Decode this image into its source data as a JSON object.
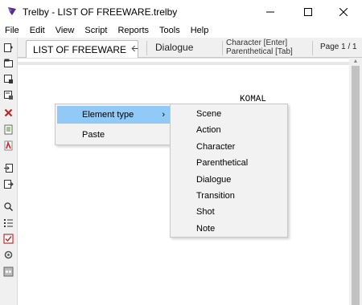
{
  "window": {
    "title": "Trelby - LIST OF FREEWARE.trelby",
    "app_icon": "trelby-logo-icon",
    "controls": [
      "minimize-icon",
      "maximize-icon",
      "close-icon"
    ]
  },
  "menubar": {
    "items": [
      "File",
      "Edit",
      "View",
      "Script",
      "Reports",
      "Tools",
      "Help"
    ]
  },
  "tabs": {
    "active_tab": "LIST OF FREEWARE",
    "current_element": "Dialogue",
    "hint_line1": "Character [Enter]",
    "hint_line2": "Parenthetical [Tab]",
    "page_indicator": "Page 1 / 1"
  },
  "toolbar": {
    "icons": [
      "new-document-icon",
      "open-icon",
      "save-icon",
      "save-as-icon",
      "close-document-icon",
      "script-settings-icon",
      "pdf-export-icon",
      "import-icon",
      "export-icon",
      "find-icon",
      "character-list-icon",
      "spellcheck-icon",
      "settings-icon",
      "about-icon"
    ]
  },
  "editor": {
    "script_text": "KOMAL"
  },
  "context_menu": {
    "items": [
      {
        "label": "Element type",
        "has_submenu": true,
        "highlighted": true
      },
      {
        "label": "Paste",
        "has_submenu": false,
        "highlighted": false
      }
    ]
  },
  "submenu": {
    "items": [
      "Scene",
      "Action",
      "Character",
      "Parenthetical",
      "Dialogue",
      "Transition",
      "Shot",
      "Note"
    ]
  },
  "colors": {
    "highlight": "#91c9f7",
    "menu_bg": "#f2f2f2",
    "chrome_bg": "#f0f0f0",
    "app_accent": "#5a2b8a"
  }
}
